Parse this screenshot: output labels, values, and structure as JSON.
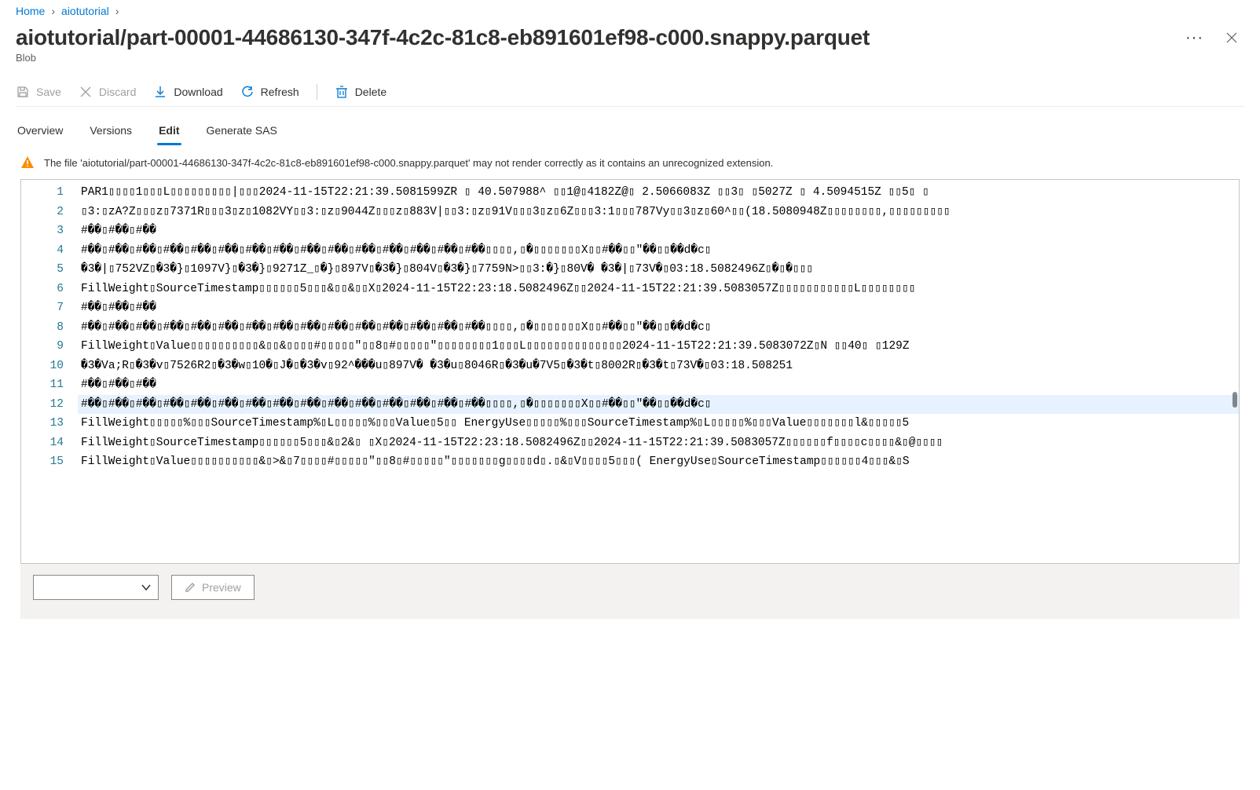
{
  "breadcrumb": {
    "items": [
      "Home",
      "aiotutorial"
    ]
  },
  "header": {
    "title": "aiotutorial/part-00001-44686130-347f-4c2c-81c8-eb891601ef98-c000.snappy.parquet",
    "subtitle": "Blob"
  },
  "toolbar": {
    "save": "Save",
    "discard": "Discard",
    "download": "Download",
    "refresh": "Refresh",
    "delete": "Delete"
  },
  "tabs": {
    "overview": "Overview",
    "versions": "Versions",
    "edit": "Edit",
    "generate_sas": "Generate SAS"
  },
  "warning": {
    "text": "The file 'aiotutorial/part-00001-44686130-347f-4c2c-81c8-eb891601ef98-c000.snappy.parquet' may not render correctly as it contains an unrecognized extension."
  },
  "editor": {
    "lines": [
      "PAR1▯▯▯▯1▯▯▯L▯▯▯▯▯▯▯▯▯|▯▯▯2024-11-15T22:21:39.5081599ZR ▯ 40.507988^ ▯▯1@▯4182Z@▯ 2.5066083Z ▯▯3▯ ▯5027Z ▯ 4.5094515Z ▯▯5▯ ▯",
      "▯3:▯zA?Z▯▯▯z▯7371R▯▯▯3▯z▯1082VY▯▯3:▯z▯9044Z▯▯▯z▯883V|▯▯3:▯z▯91V▯▯▯3▯z▯6Z▯▯▯3:1▯▯▯787Vy▯▯3▯z▯60^▯▯(18.5080948Z▯▯▯▯▯▯▯▯,▯▯▯▯▯▯▯▯▯",
      "#��▯#��▯#��",
      "#��▯#��▯#��▯#��▯#��▯#��▯#��▯#��▯#��▯#��▯#��▯#��▯#��▯#��▯#��▯▯▯▯,▯�▯▯▯▯▯▯▯X▯▯#��▯▯\"��▯▯��d�c▯",
      "�3�|▯752VZ▯�3�}▯1097V}▯�3�}▯9271Z_▯�}▯897V▯�3�}▯804V▯�3�}▯7759N>▯▯3:�}▯80V�   �3�|▯73V�▯03:18.5082496Z▯�▯�▯▯▯",
      "FillWeight▯SourceTimestamp▯▯▯▯▯▯5▯▯▯&▯▯&▯▯X▯2024-11-15T22:23:18.5082496Z▯▯2024-11-15T22:21:39.5083057Z▯▯▯▯▯▯▯▯▯▯▯L▯▯▯▯▯▯▯▯",
      "#��▯#��▯#��",
      "#��▯#��▯#��▯#��▯#��▯#��▯#��▯#��▯#��▯#��▯#��▯#��▯#��▯#��▯#��▯▯▯▯,▯�▯▯▯▯▯▯▯X▯▯#��▯▯\"��▯▯��d�c▯",
      "FillWeight▯Value▯▯▯▯▯▯▯▯▯▯&▯▯&▯▯▯▯#▯▯▯▯▯\"▯▯8▯#▯▯▯▯▯\"▯▯▯▯▯▯▯▯1▯▯▯L▯▯▯▯▯▯▯▯▯▯▯▯▯▯2024-11-15T22:21:39.5083072Z▯N ▯▯40▯ ▯129Z",
      "�3�Va;R▯�3�v▯7526R2▯�3�w▯10�▯J�▯�3�v▯92^���u▯897V� �3�u▯8046R▯�3�u�7V5▯�3�t▯8002R▯�3�t▯73V�▯03:18.508251",
      "#��▯#��▯#��",
      "#��▯#��▯#��▯#��▯#��▯#��▯#��▯#��▯#��▯#��▯#��▯#��▯#��▯#��▯#��▯▯▯▯,▯�▯▯▯▯▯▯▯X▯▯#��▯▯\"��▯▯��d�c▯",
      "FillWeight▯▯▯▯▯%▯▯▯SourceTimestamp%▯L▯▯▯▯▯%▯▯▯Value▯5▯▯    EnergyUse▯▯▯▯▯%▯▯▯SourceTimestamp%▯L▯▯▯▯▯%▯▯▯Value▯▯▯▯▯▯▯l&▯▯▯▯▯5",
      "FillWeight▯SourceTimestamp▯▯▯▯▯▯5▯▯▯&▯2&▯ ▯X▯2024-11-15T22:23:18.5082496Z▯▯2024-11-15T22:21:39.5083057Z▯▯▯▯▯▯f▯▯▯▯c▯▯▯▯&▯@▯▯▯▯",
      "FillWeight▯Value▯▯▯▯▯▯▯▯▯▯&▯>&▯7▯▯▯▯#▯▯▯▯▯\"▯▯8▯#▯▯▯▯▯\"▯▯▯▯▯▯▯g▯▯▯▯d▯.▯&▯V▯▯▯▯5▯▯▯(   EnergyUse▯SourceTimestamp▯▯▯▯▯▯4▯▯▯&▯S"
    ],
    "highlighted_line_index": 11
  },
  "bottom": {
    "preview_label": "Preview"
  }
}
